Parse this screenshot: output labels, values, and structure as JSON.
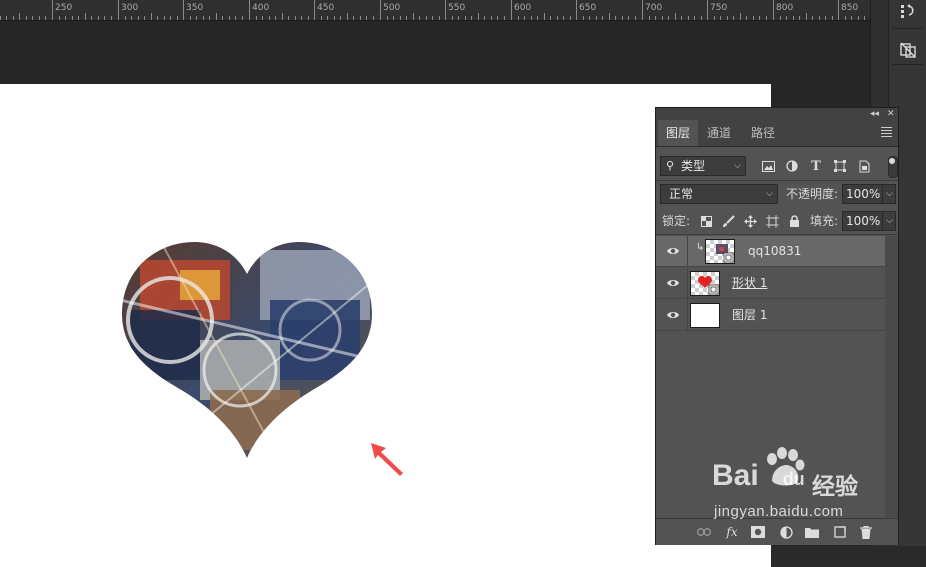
{
  "ruler": {
    "labels": [
      "250",
      "300",
      "350",
      "400",
      "450",
      "500",
      "550",
      "600",
      "650",
      "700",
      "750",
      "800",
      "850"
    ]
  },
  "layers_panel": {
    "tabs": [
      {
        "label": "图层",
        "active": true
      },
      {
        "label": "通道",
        "active": false
      },
      {
        "label": "路径",
        "active": false
      }
    ],
    "filter_kind": "类型",
    "blend_mode": "正常",
    "opacity_label": "不透明度:",
    "opacity_value": "100%",
    "lock_label": "锁定:",
    "fill_label": "填充:",
    "fill_value": "100%",
    "layers": [
      {
        "name": "qq10831",
        "visible": true,
        "selected": true,
        "clipped": true
      },
      {
        "name": "形状 1",
        "visible": true,
        "selected": false,
        "clipped": false
      },
      {
        "name": "图层 1",
        "visible": true,
        "selected": false,
        "clipped": false
      }
    ],
    "footer_fx": "fx"
  },
  "watermark": {
    "brand": "Bai",
    "brand2": "du",
    "brand_cn": "经验",
    "url": "jingyan.baidu.com"
  },
  "colors": {
    "accent_arrow": "#f04a4a",
    "panel_bg": "#535353",
    "selected_row": "#686868"
  }
}
